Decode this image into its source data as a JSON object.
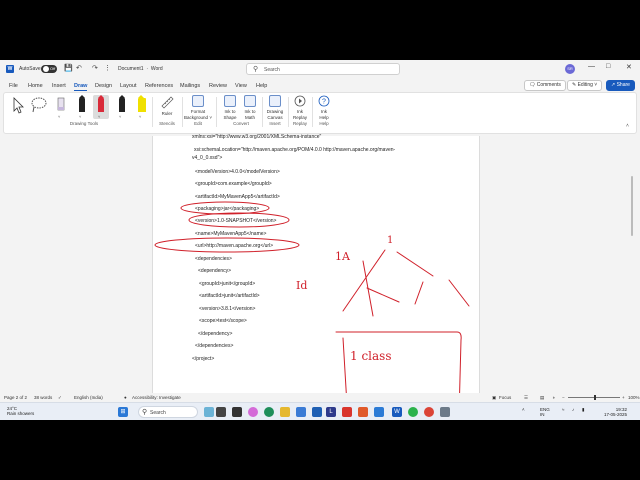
{
  "titlebar": {
    "autosave_label": "AutoSave",
    "autosave_state": "Off",
    "doc_title": "Document1",
    "app_name": "Word",
    "search_placeholder": "Search",
    "avatar_initials": "SR",
    "icons": [
      "save-icon",
      "undo-icon",
      "redo-icon",
      "minimize-icon",
      "restore-icon",
      "close-icon"
    ]
  },
  "menu": {
    "tabs": [
      "File",
      "Home",
      "Insert",
      "Draw",
      "Design",
      "Layout",
      "References",
      "Mailings",
      "Review",
      "View",
      "Help"
    ],
    "active_tab": "Draw",
    "comments": "Comments",
    "editing": "Editing",
    "share": "Share"
  },
  "ribbon": {
    "drawing_tools_group": "Drawing Tools",
    "ruler": "Ruler",
    "stencils_group": "Stencils",
    "format_background": [
      "Format",
      "Background"
    ],
    "edit_group": "Edit",
    "ink_to_shape": [
      "Ink to",
      "Shape"
    ],
    "ink_to_math": [
      "Ink to",
      "Math"
    ],
    "convert_group": "Convert",
    "drawing_canvas": [
      "Drawing",
      "Canvas"
    ],
    "insert_group": "Insert",
    "ink_replay": [
      "Ink",
      "Replay"
    ],
    "replay_group": "Replay",
    "ink_help": [
      "Ink",
      "Help"
    ],
    "help_group": "Help",
    "pen_colors": [
      "#000000",
      "#d92b3a",
      "#000000",
      "#f0e000"
    ]
  },
  "document": {
    "lines": [
      "xmlns:xsi=\"http://www.w3.org/2001/XMLSchema-instance\"",
      "xsi:schemaLocation=\"http://maven.apache.org/POM/4.0.0 http://maven.apache.org/maven-",
      "v4_0_0.xsd\">",
      "<modelVersion>4.0.0</modelVersion>",
      "<groupId>com.example</groupId>",
      "<artifactId>MyMavenApp5</artifactId>",
      "<packaging>jar</packaging>",
      "<version>1.0-SNAPSHOT</version>",
      "<name>MyMavenApp5</name>",
      "<url>http://maven.apache.org</url>",
      "<dependencies>",
      "<dependency>",
      "<groupId>junit</groupId>",
      "<artifactId>junit</artifactId>",
      "<version>3.8.1</version>",
      "<scope>test</scope>",
      "</dependency>",
      "</dependencies>",
      "</project>"
    ],
    "ink_annotations": {
      "label_1": "1",
      "label_a": "1A",
      "label_id": "Id",
      "box_text": "1  class",
      "ink_color": "#d0202a"
    }
  },
  "statusbar": {
    "page": "Page 2 of 2",
    "words": "38 words",
    "language": "English (India)",
    "accessibility": "Accessibility: Investigate",
    "focus": "Focus",
    "zoom": "100%"
  },
  "taskbar": {
    "weather_temp": "24°C",
    "weather_desc": "Rain showers",
    "search": "Search",
    "lang_top": "ENG",
    "lang_bottom": "IN",
    "time": "19:32",
    "date": "17-05-2025"
  }
}
